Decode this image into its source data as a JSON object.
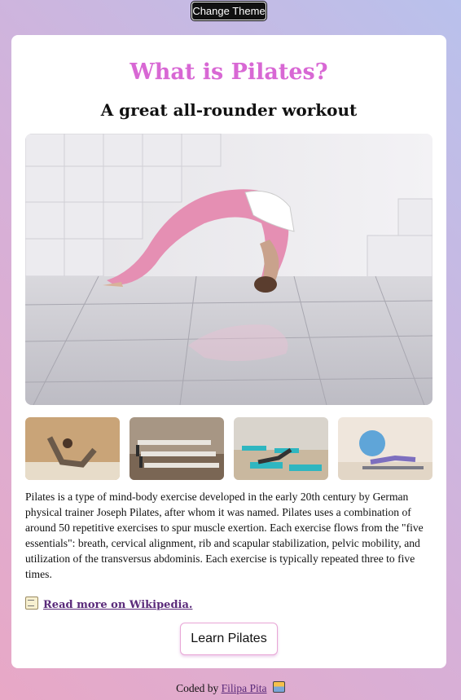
{
  "theme_button": {
    "label": "Change Theme"
  },
  "card": {
    "title": "What is Pilates?",
    "subtitle": "A great all-rounder workout",
    "hero_image": {
      "alt": "Woman in pink leggings holding a backbend pose"
    },
    "thumbnails": [
      {
        "alt": "Woman doing a V-sit on a mat"
      },
      {
        "alt": "Reformer machines in a studio"
      },
      {
        "alt": "Group class on turquoise mats"
      },
      {
        "alt": "Woman using a blue exercise ball"
      }
    ],
    "paragraph": "Pilates is a type of mind-body exercise developed in the early 20th century by German physical trainer Joseph Pilates, after whom it was named. Pilates uses a combination of around 50 repetitive exercises to spur muscle exertion. Each exercise flows from the \"five essentials\": breath, cervical alignment, rib and scapular stabilization, pelvic mobility, and utilization of the transversus abdominis. Each exercise is typically repeated three to five times.",
    "wiki_link": {
      "icon": "memo-icon",
      "label": "Read more on Wikipedia."
    },
    "learn_button": {
      "label": "Learn Pilates"
    }
  },
  "footer": {
    "prefix": "Coded by",
    "author": "Filipa Pita",
    "icon": "laptop-icon"
  },
  "colors": {
    "title": "#d868d4",
    "link": "#5a2a7a",
    "button_border": "#e8a6d6"
  }
}
